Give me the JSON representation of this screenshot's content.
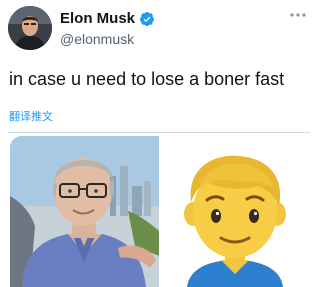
{
  "tweet": {
    "author": {
      "display_name": "Elon Musk",
      "handle": "@elonmusk",
      "verified": true,
      "avatar_icon": "profile-photo"
    },
    "text": "in case u need to lose a boner fast",
    "translate_label": "翻译推文",
    "more_icon": "more-horizontal-icon"
  },
  "colors": {
    "text": "#0f1419",
    "muted": "#536471",
    "link": "#1d9bf0",
    "verified": "#1d9bf0"
  }
}
